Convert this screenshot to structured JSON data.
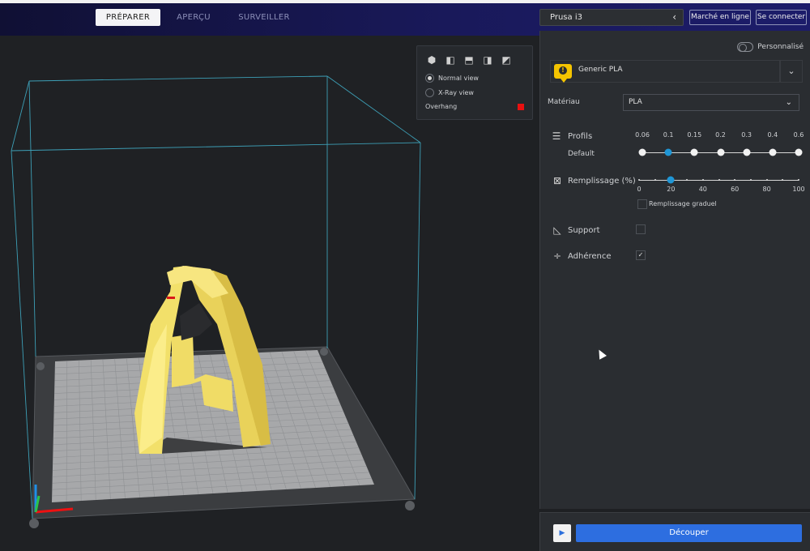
{
  "topbar": {
    "tabs": [
      {
        "label": "PRÉPARER",
        "active": true
      },
      {
        "label": "APERÇU",
        "active": false
      },
      {
        "label": "SURVEILLER",
        "active": false
      }
    ],
    "printer": "Prusa i3",
    "marketplace_label": "Marché en ligne",
    "signin_label": "Se connecter"
  },
  "view_panel": {
    "icons": [
      "3d-view-icon",
      "front-view-icon",
      "top-view-icon",
      "left-view-icon",
      "right-view-icon"
    ],
    "normal_view": "Normal view",
    "xray_view": "X-Ray view",
    "overhang": "Overhang",
    "overhang_color": "#e81010",
    "selected_view": "Normal view"
  },
  "settings": {
    "custom_label": "Personnalisé",
    "material_name": "Generic PLA",
    "material_label": "Matériau",
    "material_value": "PLA",
    "profiles_label": "Profils",
    "profile_default": "Default",
    "layer_heights": [
      "0.06",
      "0.1",
      "0.15",
      "0.2",
      "0.3",
      "0.4",
      "0.6"
    ],
    "selected_layer_height": "0.1",
    "infill_label": "Remplissage (%)",
    "infill_ticks": [
      "0",
      "20",
      "40",
      "60",
      "80",
      "100"
    ],
    "infill_value": 20,
    "gradual_infill_label": "Remplissage graduel",
    "gradual_infill": false,
    "support_label": "Support",
    "support": false,
    "adhesion_label": "Adhérence",
    "adhesion": true,
    "check_mark": "✓"
  },
  "bottom": {
    "slice_label": "Découper"
  },
  "colors": {
    "accent": "#2d6ee0",
    "selected_dot": "#1f96d6",
    "model": "#f8e36c",
    "warning": "#f5c400"
  }
}
